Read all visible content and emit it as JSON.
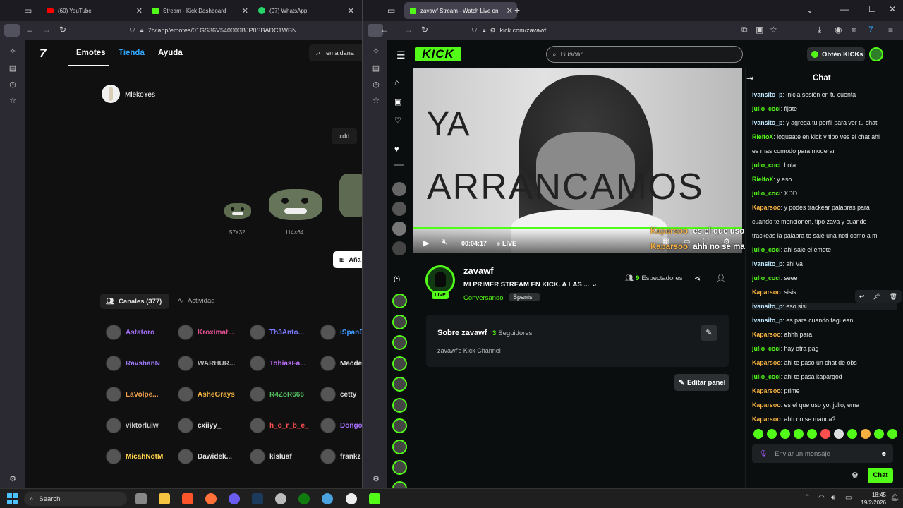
{
  "left_browser": {
    "tabs": [
      {
        "label": "(60) YouTube"
      },
      {
        "label": "Stream - Kick Dashboard"
      },
      {
        "label": "(97) WhatsApp"
      }
    ],
    "url": "7tv.app/emotes/01GS36V540000BJP0SBADC1WBN"
  },
  "right_browser": {
    "tabs": [
      {
        "label": "zavawf Stream - Watch Live on"
      }
    ],
    "new_tab": "+",
    "url": "kick.com/zavawf"
  },
  "seventv": {
    "nav": [
      "Emotes",
      "Tienda",
      "Ayuda"
    ],
    "search_value": "emaldana",
    "owner": "MlekoYes",
    "tag": "xdd",
    "sizes": [
      "57×32",
      "114×64"
    ],
    "add_button": "Aña",
    "tabs": {
      "channels": "Canales (377)",
      "activity": "Actividad"
    },
    "channels": [
      [
        "Astatoro",
        "Kroximat...",
        "Th3Anto...",
        "iSpanD"
      ],
      [
        "RavshanN",
        "WARHUR...",
        "TobiasFa...",
        "Macde"
      ],
      [
        "LaVolpe...",
        "AsheGrays",
        "R4ZoR666",
        "cetty"
      ],
      [
        "viktorluiw",
        "cxiiyy_",
        "h_o_r_b_e_",
        "Dongol"
      ],
      [
        "MicahNotM",
        "Dawidek...",
        "kisluaf",
        "frankz"
      ]
    ],
    "channel_colors": [
      [
        "#a06cf0",
        "#e05090",
        "#7a7aff",
        "#3f9cff"
      ],
      [
        "#9b7af5",
        "#b4b4b4",
        "#c070ff",
        "#dddddd"
      ],
      [
        "#f0a050",
        "#f0b040",
        "#55c060",
        "#dddddd"
      ],
      [
        "#cccccc",
        "#e8e8e8",
        "#ff5050",
        "#a870ff"
      ],
      [
        "#ffd24a",
        "#e0e0e0",
        "#e0e0e0",
        "#dddddd"
      ]
    ]
  },
  "kick": {
    "search_placeholder": "Buscar",
    "get_kicks": "Obtén KICKs",
    "video": {
      "overlay_line1": "YA",
      "overlay_line2": "ARRANCAMOS",
      "time": "00:04:17",
      "live": "LIVE",
      "chat_overlay": [
        {
          "user": "Kaparsoo",
          "msg": "es el que uso yo, julio, ema"
        },
        {
          "user": "Kaparsoo",
          "msg": "ahh no se manda?"
        }
      ]
    },
    "channel": {
      "name": "zavawf",
      "title": "MI PRIMER STREAM EN KICK. A LAS ...",
      "category": "Conversando",
      "language": "Spanish",
      "live_badge": "LIVE",
      "viewers_count": "9",
      "viewers_label": "Espectadores"
    },
    "about": {
      "title": "Sobre zavawf",
      "followers_count": "3",
      "followers_label": "Seguidores",
      "description": "zavawf's Kick Channel"
    },
    "edit_panel": "Editar panel",
    "chat": {
      "title": "Chat",
      "input_placeholder": "Enviar un mensaje",
      "send": "Chat",
      "messages": [
        {
          "user": "ivansito_p",
          "color": "#bfe8ff",
          "text": "inicia sesión en tu cuenta"
        },
        {
          "user": "julio_coci",
          "color": "#53fc18",
          "text": "fijate"
        },
        {
          "user": "ivansito_p",
          "color": "#bfe8ff",
          "text": "y agrega tu perfil para ver tu chat"
        },
        {
          "user": "RieltoX",
          "color": "#53fc18",
          "text": "logueate en kick y tipo ves el chat ahi"
        },
        {
          "user": "",
          "color": "#ffffff",
          "text": "es mas comodo para moderar"
        },
        {
          "user": "julio_coci",
          "color": "#53fc18",
          "text": "hola"
        },
        {
          "user": "RieltoX",
          "color": "#53fc18",
          "text": "y eso"
        },
        {
          "user": "julio_coci",
          "color": "#53fc18",
          "text": "XDD"
        },
        {
          "user": "Kaparsoo",
          "color": "#f5b041",
          "text": "y podes trackear palabras para"
        },
        {
          "user": "",
          "color": "#ffffff",
          "text": "cuando te mencionen, tipo zava y cuando"
        },
        {
          "user": "",
          "color": "#ffffff",
          "text": "trackeas la palabra te sale una noti como a mi"
        },
        {
          "user": "julio_coci",
          "color": "#53fc18",
          "text": "ahi sale el emote"
        },
        {
          "user": "ivansito_p",
          "color": "#bfe8ff",
          "text": "ahi va"
        },
        {
          "user": "julio_coci",
          "color": "#53fc18",
          "text": "seee"
        },
        {
          "user": "Kaparsoo",
          "color": "#f5b041",
          "text": "sisis"
        },
        {
          "user": "ivansito_p",
          "color": "#bfe8ff",
          "text": "eso sisi"
        },
        {
          "user": "ivansito_p",
          "color": "#bfe8ff",
          "text": "es para cuando taguean"
        },
        {
          "user": "Kaparsoo",
          "color": "#f5b041",
          "text": "ahhh para"
        },
        {
          "user": "julio_coci",
          "color": "#53fc18",
          "text": "hay otra pag"
        },
        {
          "user": "Kaparsoo",
          "color": "#f5b041",
          "text": "ahi te paso un chat de obs"
        },
        {
          "user": "julio_coci",
          "color": "#53fc18",
          "text": "ahi te pasa kapargod"
        },
        {
          "user": "Kaparsoo",
          "color": "#f5b041",
          "text": "prime"
        },
        {
          "user": "Kaparsoo",
          "color": "#f5b041",
          "text": "es el que uso yo, julio, ema"
        },
        {
          "user": "Kaparsoo",
          "color": "#f5b041",
          "text": "ahh no se manda?"
        }
      ]
    }
  },
  "taskbar": {
    "search": "Search",
    "time": "18:45",
    "date": "19/2/2026"
  }
}
